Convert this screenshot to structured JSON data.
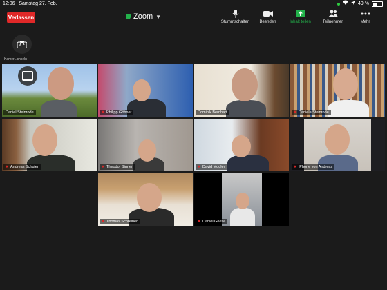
{
  "status": {
    "time": "12:06",
    "date": "Samstag 27. Feb.",
    "battery": "49 %"
  },
  "header": {
    "leave_label": "Verlassen",
    "title": "Zoom"
  },
  "toolbar": {
    "mute": "Stummschalten",
    "stop_video": "Beenden",
    "share": "Inhalt teilen",
    "participants": "Teilnehmer",
    "more": "Mehr"
  },
  "camera": {
    "label": "Kamer...chseln"
  },
  "participants": [
    {
      "name": "Daniel Steinrode",
      "muted": false,
      "active": true
    },
    {
      "name": "Philipp Göhner",
      "muted": true
    },
    {
      "name": "Dominik Bernhart",
      "muted": false
    },
    {
      "name": "Daniela Steinrode",
      "muted": true
    },
    {
      "name": "Andreas Schuler",
      "muted": true
    },
    {
      "name": "Theodor Sinner",
      "muted": true
    },
    {
      "name": "David Mogler",
      "muted": true
    },
    {
      "name": "iPhone von Andreas",
      "muted": true
    },
    {
      "name": "Thomas Schreiber",
      "muted": true
    },
    {
      "name": "Daniel Geese",
      "muted": true
    }
  ]
}
